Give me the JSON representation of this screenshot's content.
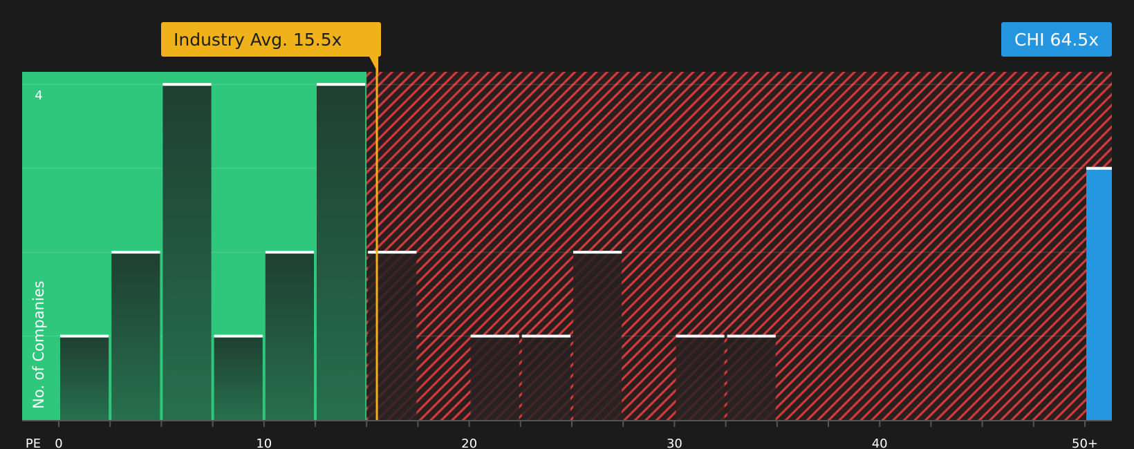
{
  "chart_data": {
    "type": "bar",
    "xlabel": "PE",
    "ylabel": "No. of Companies",
    "x_ticks": [
      "0",
      "10",
      "20",
      "30",
      "40",
      "50+"
    ],
    "y_ticks": [
      "4"
    ],
    "ylim": [
      0,
      4.15
    ],
    "bin_width": 2.5,
    "bins": [
      {
        "start": 0,
        "count": 1
      },
      {
        "start": 2.5,
        "count": 2
      },
      {
        "start": 5,
        "count": 4
      },
      {
        "start": 7.5,
        "count": 1
      },
      {
        "start": 10,
        "count": 2
      },
      {
        "start": 12.5,
        "count": 4
      },
      {
        "start": 15,
        "count": 2
      },
      {
        "start": 17.5,
        "count": 0
      },
      {
        "start": 20,
        "count": 1
      },
      {
        "start": 22.5,
        "count": 1
      },
      {
        "start": 25,
        "count": 2
      },
      {
        "start": 27.5,
        "count": 0
      },
      {
        "start": 30,
        "count": 1
      },
      {
        "start": 32.5,
        "count": 1
      },
      {
        "start": 35,
        "count": 0
      },
      {
        "start": 37.5,
        "count": 0
      },
      {
        "start": 40,
        "count": 0
      },
      {
        "start": 42.5,
        "count": 0
      },
      {
        "start": 45,
        "count": 0
      },
      {
        "start": 47.5,
        "count": 0
      }
    ],
    "company": {
      "ticker": "CHI",
      "pe": 64.5,
      "label": "CHI 64.5x",
      "bar_count": 3
    },
    "industry_avg": {
      "pe": 15.5,
      "label": "Industry Avg. 15.5x"
    },
    "colors": {
      "background": "#1b1b1b",
      "undervalued_zone": "#2ec77c",
      "overvalued_hatch": "#d23a3a",
      "industry": "#f0b21b",
      "company": "#2496e0",
      "bar_cap": "#ffffff"
    }
  }
}
